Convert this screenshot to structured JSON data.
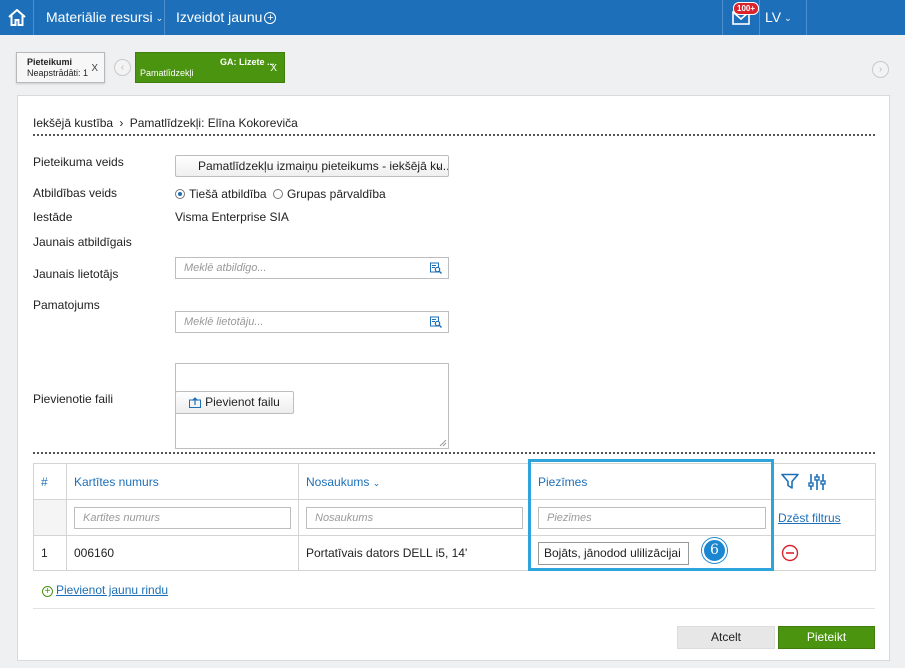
{
  "topbar": {
    "menu_resources": "Materiālie resursi",
    "menu_create": "Izveidot jaunu",
    "mail_badge": "100+",
    "language": "LV",
    "icons": [
      "home-icon",
      "chevron-down-icon",
      "plus-circle-icon",
      "mail-icon"
    ]
  },
  "tabs": [
    {
      "title": "Pieteikumi",
      "subtitle": "Neapstrādāti: 1",
      "close": "X"
    },
    {
      "title": "GA: Lizete ...",
      "subtitle": "Pamatlīdzekļi",
      "close": "X"
    }
  ],
  "nav_arrows": {
    "prev": "‹",
    "next": "›"
  },
  "breadcrumb": {
    "part1": "Iekšējā kustība",
    "sep": "›",
    "part2": "Pamatlīdzekļi: Elīna Kokoreviča"
  },
  "form": {
    "request_type_label": "Pieteikuma veids",
    "request_type_value": "Pamatlīdzekļu izmaiņu pieteikums - iekšējā ku...",
    "responsibility_label": "Atbildības veids",
    "responsibility_opt1": "Tiešā atbildība",
    "responsibility_opt2": "Grupas pārvaldība",
    "institution_label": "Iestāde",
    "institution_value": "Visma Enterprise SIA",
    "new_responsible_label": "Jaunais atbildīgais",
    "new_responsible_placeholder": "Meklē atbildīgo...",
    "new_user_label": "Jaunais lietotājs",
    "new_user_placeholder": "Meklē lietotāju...",
    "justification_label": "Pamatojums",
    "attachments_label": "Pievienotie faili",
    "add_file_button": "Pievienot failu"
  },
  "table": {
    "headers": {
      "num": "#",
      "card": "Kartītes numurs",
      "name": "Nosaukums",
      "notes": "Piezīmes"
    },
    "filters": {
      "card": "Kartītes numurs",
      "name": "Nosaukums",
      "notes": "Piezīmes",
      "clear": "Dzēst filtrus"
    },
    "rows": [
      {
        "num": "1",
        "card": "006160",
        "name": "Portatīvais dators DELL i5, 14'",
        "notes": "Bojāts, jānodod ulilizācijai"
      }
    ]
  },
  "callout_number": "6",
  "add_row_link": "Pievienot jaunu rindu",
  "actions": {
    "cancel": "Atcelt",
    "submit": "Pieteikt"
  },
  "colors": {
    "topbar": "#1c6fb8",
    "accent_green": "#4b9410",
    "highlight": "#2ea4dd",
    "delete_red": "#d9232d"
  }
}
